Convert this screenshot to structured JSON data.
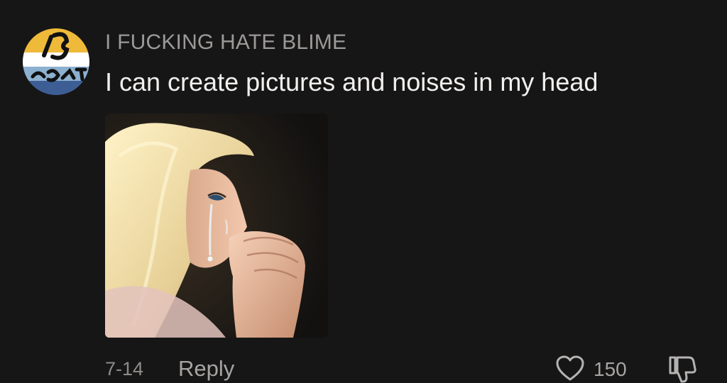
{
  "comment": {
    "username": "I FUCKING HATE BLIME",
    "text": "I can create pictures and noises in my head",
    "date": "7-14",
    "reply_label": "Reply",
    "like_count": "150",
    "avatar_text": "TO AONE",
    "avatar_colors": [
      "#efb93a",
      "#ffffff",
      "#8cb0cf",
      "#3d5e95"
    ],
    "attached_image_description": "photo of crying blonde doll with clasped hands"
  },
  "icons": {
    "like": "heart-outline-icon",
    "dislike": "thumbs-down-outline-icon"
  },
  "colors": {
    "background": "#171616",
    "primary_text": "#f2f0ee",
    "secondary_text": "#9c9a98"
  }
}
